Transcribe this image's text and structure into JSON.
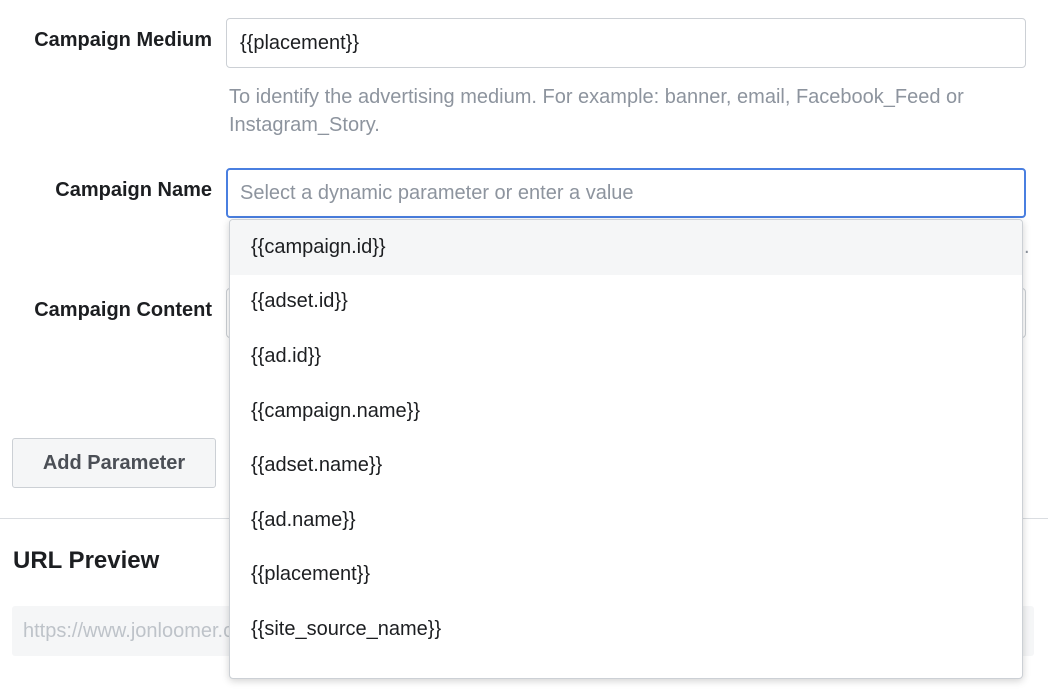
{
  "fields": {
    "medium": {
      "label": "Campaign Medium",
      "value": "{{placement}}",
      "help": "To identify the advertising medium. For example: banner, email, Facebook_Feed or Instagram_Story."
    },
    "name": {
      "label": "Campaign Name",
      "placeholder": "Select a dynamic parameter or enter a value",
      "help_tail": "."
    },
    "content": {
      "label": "Campaign Content"
    }
  },
  "add_parameter_label": "Add Parameter",
  "url_preview": {
    "title": "URL Preview",
    "value": "https://www.jonloomer.com"
  },
  "dropdown": {
    "highlighted_index": 0,
    "options": [
      "{{campaign.id}}",
      "{{adset.id}}",
      "{{ad.id}}",
      "{{campaign.name}}",
      "{{adset.name}}",
      "{{ad.name}}",
      "{{placement}}",
      "{{site_source_name}}"
    ]
  }
}
